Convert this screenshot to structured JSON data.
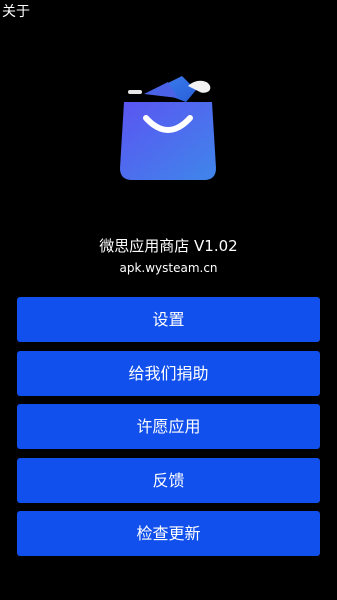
{
  "header": {
    "title": "关于"
  },
  "app": {
    "logo_icon": "shopping-bag-icon",
    "name": "微思应用商店 V1.02",
    "url": "apk.wysteam.cn"
  },
  "menu": {
    "items": [
      {
        "label": "设置"
      },
      {
        "label": "给我们捐助"
      },
      {
        "label": "许愿应用"
      },
      {
        "label": "反馈"
      },
      {
        "label": "检查更新"
      }
    ]
  },
  "colors": {
    "background": "#000000",
    "button": "#1150ec",
    "text": "#ffffff",
    "logo_gradient_start": "#5a5cf0",
    "logo_gradient_end": "#3d86ea"
  }
}
